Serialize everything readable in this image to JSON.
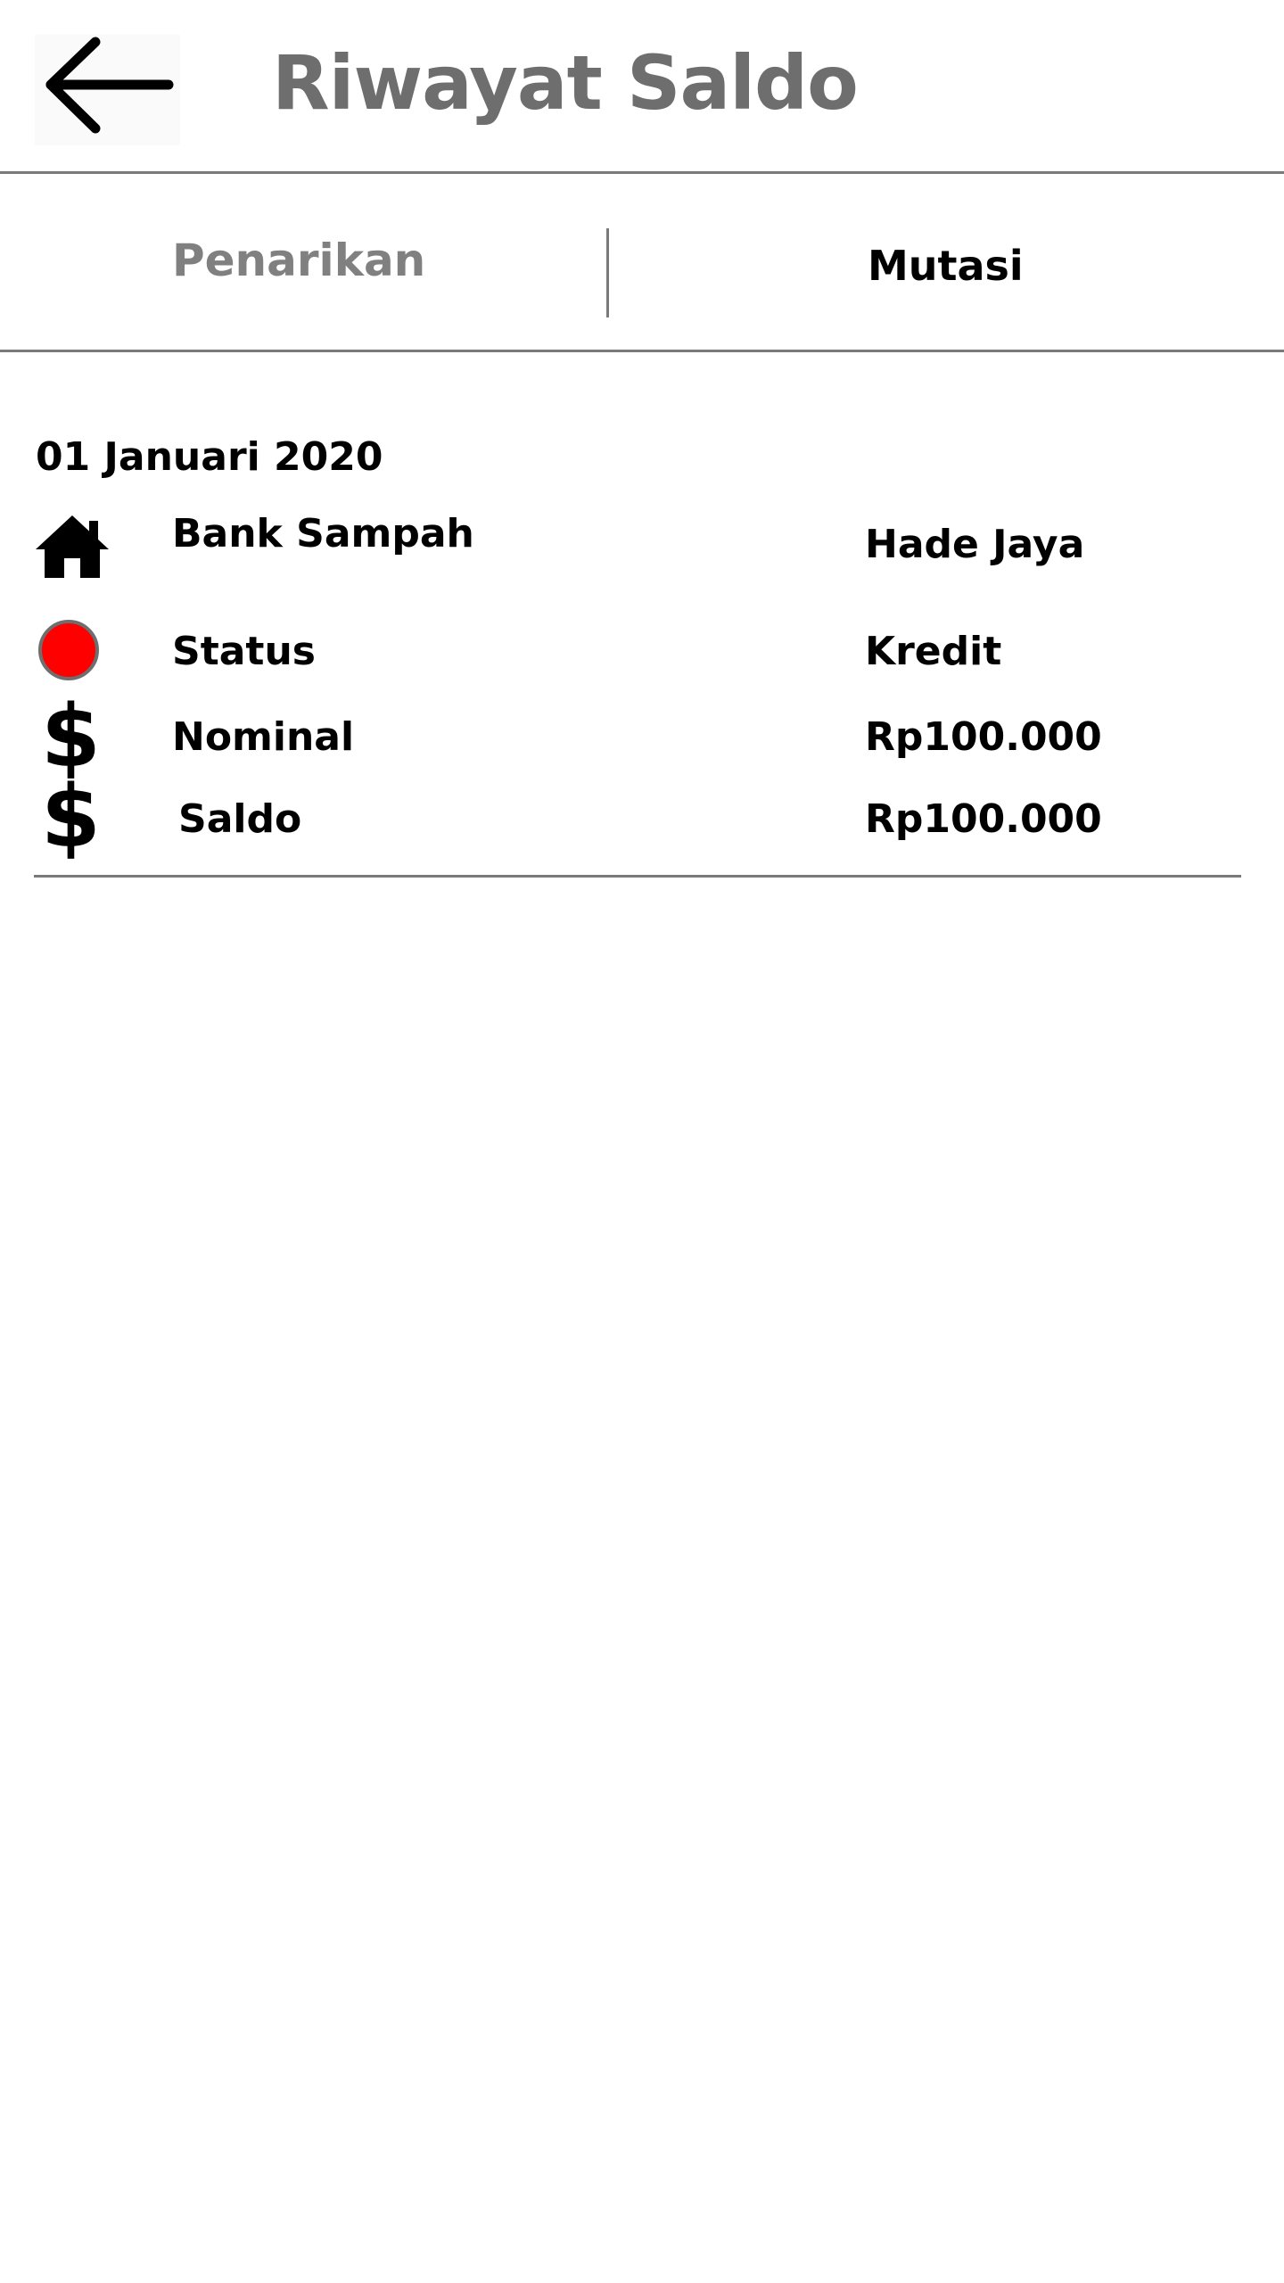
{
  "header": {
    "title": "Riwayat Saldo",
    "back_icon": "arrow-left-icon"
  },
  "tabs": [
    {
      "label": "Penarikan",
      "active": false
    },
    {
      "label": "Mutasi",
      "active": true
    }
  ],
  "entries": [
    {
      "date": "01 Januari 2020",
      "rows": [
        {
          "icon": "house-icon",
          "label": "Bank Sampah",
          "value": "Hade Jaya"
        },
        {
          "icon": "red-status-dot-icon",
          "label": "Status",
          "value": "Kredit",
          "status_color": "#ff0000"
        },
        {
          "icon": "dollar-icon",
          "label": "Nominal",
          "value": "Rp100.000"
        },
        {
          "icon": "dollar-icon",
          "label": "Saldo",
          "value": "Rp100.000"
        }
      ]
    }
  ],
  "colors": {
    "title": "#6e6e6e",
    "inactive_tab": "#808080",
    "divider": "#7a7a7a",
    "status_dot": "#ff0000"
  }
}
